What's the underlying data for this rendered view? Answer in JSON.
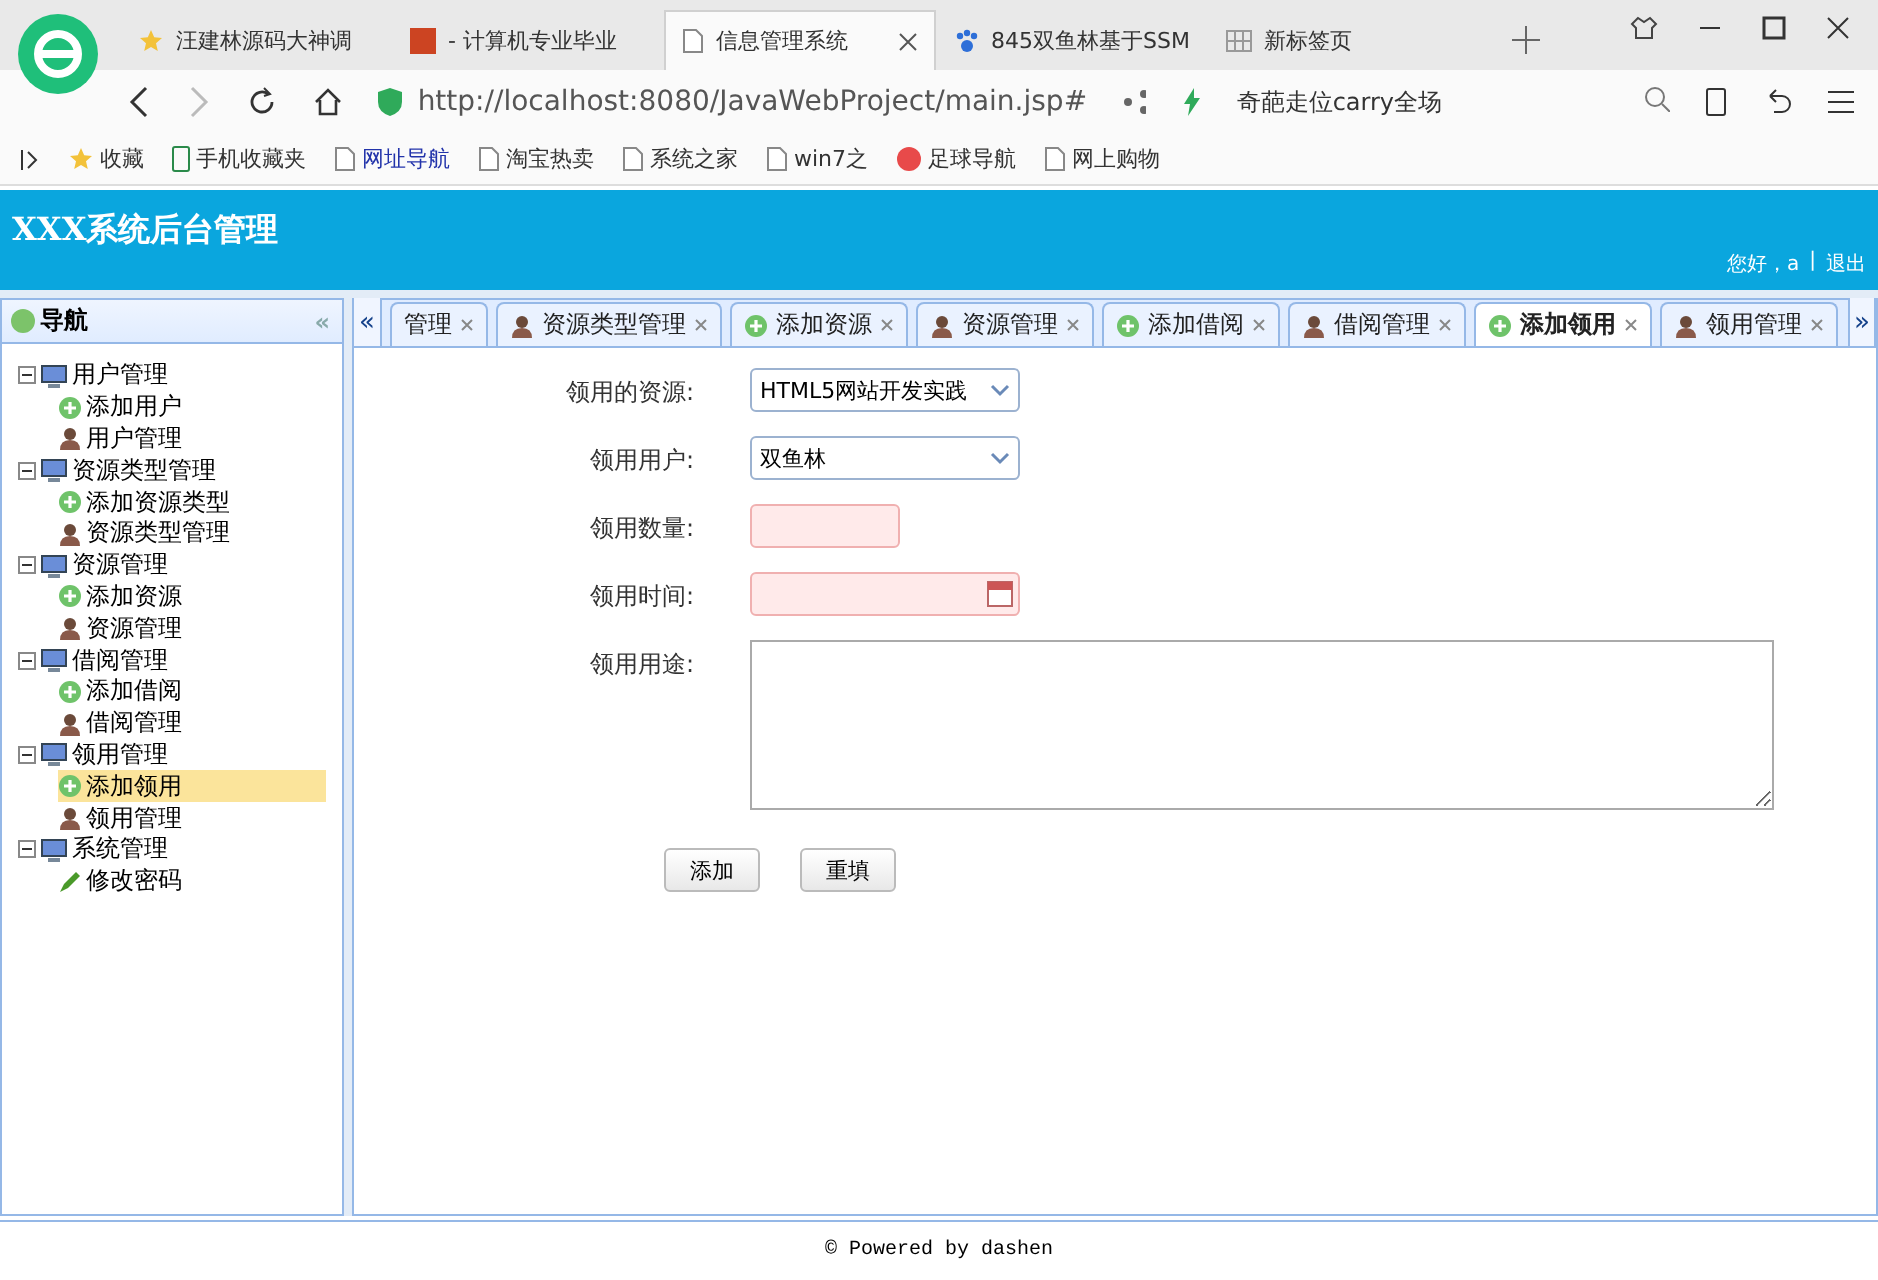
{
  "browser": {
    "tabs": [
      {
        "label": "汪建林源码大神调",
        "kind": "star",
        "selected": false
      },
      {
        "label": "- 计算机专业毕业",
        "kind": "flag",
        "selected": false
      },
      {
        "label": "信息管理系统",
        "kind": "page",
        "selected": true
      },
      {
        "label": "845双鱼林基于SSM",
        "kind": "paw",
        "selected": false
      },
      {
        "label": "新标签页",
        "kind": "grid",
        "selected": false
      }
    ],
    "address": "http://localhost:8080/JavaWebProject/main.jsp#",
    "search": "奇葩走位carry全场",
    "bookmarks": [
      {
        "label": "收藏",
        "kind": "star"
      },
      {
        "label": "手机收藏夹",
        "kind": "phone"
      },
      {
        "label": "网址导航",
        "kind": "page"
      },
      {
        "label": "淘宝热卖",
        "kind": "page"
      },
      {
        "label": "系统之家",
        "kind": "page"
      },
      {
        "label": "win7之",
        "kind": "page"
      },
      {
        "label": "足球导航",
        "kind": "ball"
      },
      {
        "label": "网上购物",
        "kind": "page"
      }
    ]
  },
  "header": {
    "title": "XXX系统后台管理",
    "greeting": "您好，a",
    "separator": "|",
    "logout": "退出"
  },
  "sidebar": {
    "title": "导航",
    "collapse": "«",
    "items": [
      {
        "label": "用户管理",
        "expanded": true,
        "children": [
          {
            "label": "添加用户",
            "kind": "add",
            "selected": false
          },
          {
            "label": "用户管理",
            "kind": "manage",
            "selected": false
          }
        ]
      },
      {
        "label": "资源类型管理",
        "expanded": true,
        "children": [
          {
            "label": "添加资源类型",
            "kind": "add",
            "selected": false
          },
          {
            "label": "资源类型管理",
            "kind": "manage",
            "selected": false
          }
        ]
      },
      {
        "label": "资源管理",
        "expanded": true,
        "children": [
          {
            "label": "添加资源",
            "kind": "add",
            "selected": false
          },
          {
            "label": "资源管理",
            "kind": "manage",
            "selected": false
          }
        ]
      },
      {
        "label": "借阅管理",
        "expanded": true,
        "children": [
          {
            "label": "添加借阅",
            "kind": "add",
            "selected": false
          },
          {
            "label": "借阅管理",
            "kind": "manage",
            "selected": false
          }
        ]
      },
      {
        "label": "领用管理",
        "expanded": true,
        "children": [
          {
            "label": "添加领用",
            "kind": "add",
            "selected": true
          },
          {
            "label": "领用管理",
            "kind": "manage",
            "selected": false
          }
        ]
      },
      {
        "label": "系统管理",
        "expanded": true,
        "children": [
          {
            "label": "修改密码",
            "kind": "edit",
            "selected": false
          }
        ]
      }
    ]
  },
  "tabs": {
    "scroll_left": "«",
    "scroll_right": "»",
    "items": [
      {
        "label": "管理",
        "kind": "none",
        "selected": false
      },
      {
        "label": "资源类型管理",
        "kind": "manage",
        "selected": false
      },
      {
        "label": "添加资源",
        "kind": "add",
        "selected": false
      },
      {
        "label": "资源管理",
        "kind": "manage",
        "selected": false
      },
      {
        "label": "添加借阅",
        "kind": "add",
        "selected": false
      },
      {
        "label": "借阅管理",
        "kind": "manage",
        "selected": false
      },
      {
        "label": "添加领用",
        "kind": "add",
        "selected": true
      },
      {
        "label": "领用管理",
        "kind": "manage",
        "selected": false
      }
    ]
  },
  "form": {
    "fields": [
      {
        "label": "领用的资源:",
        "kind": "select",
        "value": "HTML5网站开发实践"
      },
      {
        "label": "领用用户:",
        "kind": "select",
        "value": "双鱼林"
      },
      {
        "label": "领用数量:",
        "kind": "number"
      },
      {
        "label": "领用时间:",
        "kind": "date"
      },
      {
        "label": "领用用途:",
        "kind": "textarea"
      }
    ],
    "buttons": [
      "添加",
      "重填"
    ]
  },
  "footer": "© Powered by dashen"
}
